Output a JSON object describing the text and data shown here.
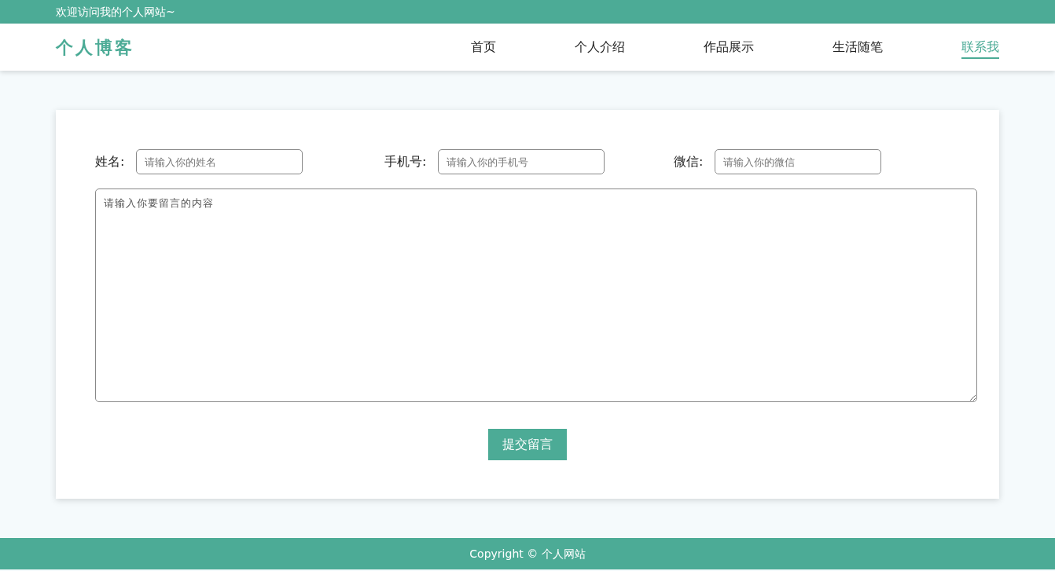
{
  "top_bar": {
    "text": "欢迎访问我的个人网站~"
  },
  "header": {
    "logo": "个人博客",
    "nav": [
      {
        "label": "首页",
        "selected": false
      },
      {
        "label": "个人介绍",
        "selected": false
      },
      {
        "label": "作品展示",
        "selected": false
      },
      {
        "label": "生活随笔",
        "selected": false
      },
      {
        "label": "联系我",
        "selected": true
      }
    ]
  },
  "form": {
    "fields": [
      {
        "label": "姓名:",
        "placeholder": "请输入你的姓名"
      },
      {
        "label": "手机号:",
        "placeholder": "请输入你的手机号"
      },
      {
        "label": "微信:",
        "placeholder": "请输入你的微信"
      }
    ],
    "message": {
      "placeholder": "请输入你要留言的内容"
    },
    "submit": "提交留言"
  },
  "footer": {
    "text": "Copyright © 个人网站"
  }
}
